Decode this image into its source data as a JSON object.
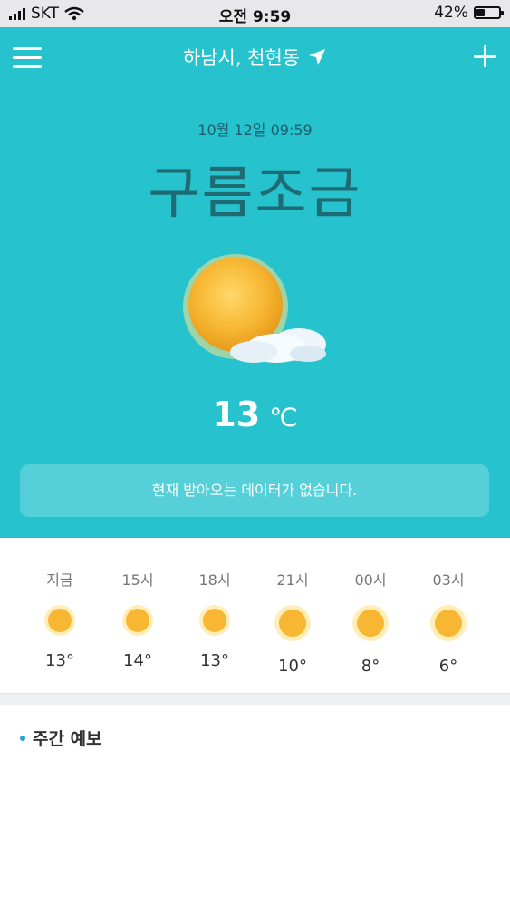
{
  "status_bar": {
    "carrier": "SKT",
    "time": "오전 9:59",
    "battery": "42%",
    "battery_level": 0.42
  },
  "header": {
    "location": "하남시, 천현동"
  },
  "current": {
    "date": "10월 12일 09:59",
    "condition": "구름조금",
    "temperature": "13",
    "unit": "℃",
    "notice": "현재 받아오는 데이터가 없습니다."
  },
  "hourly": [
    {
      "time": "지금",
      "temp": "13°",
      "icon": "sun-icon"
    },
    {
      "time": "15시",
      "temp": "14°",
      "icon": "sun-icon"
    },
    {
      "time": "18시",
      "temp": "13°",
      "icon": "sun-icon"
    },
    {
      "time": "21시",
      "temp": "10°",
      "icon": "sun-icon"
    },
    {
      "time": "00시",
      "temp": "8°",
      "icon": "sun-icon"
    },
    {
      "time": "03시",
      "temp": "6°",
      "icon": "sun-icon"
    }
  ],
  "weekly": {
    "title": "주간 예보"
  },
  "colors": {
    "hero_bg": "#26c3cf",
    "accent": "#2aa2d8",
    "sun": "#f7b733"
  }
}
